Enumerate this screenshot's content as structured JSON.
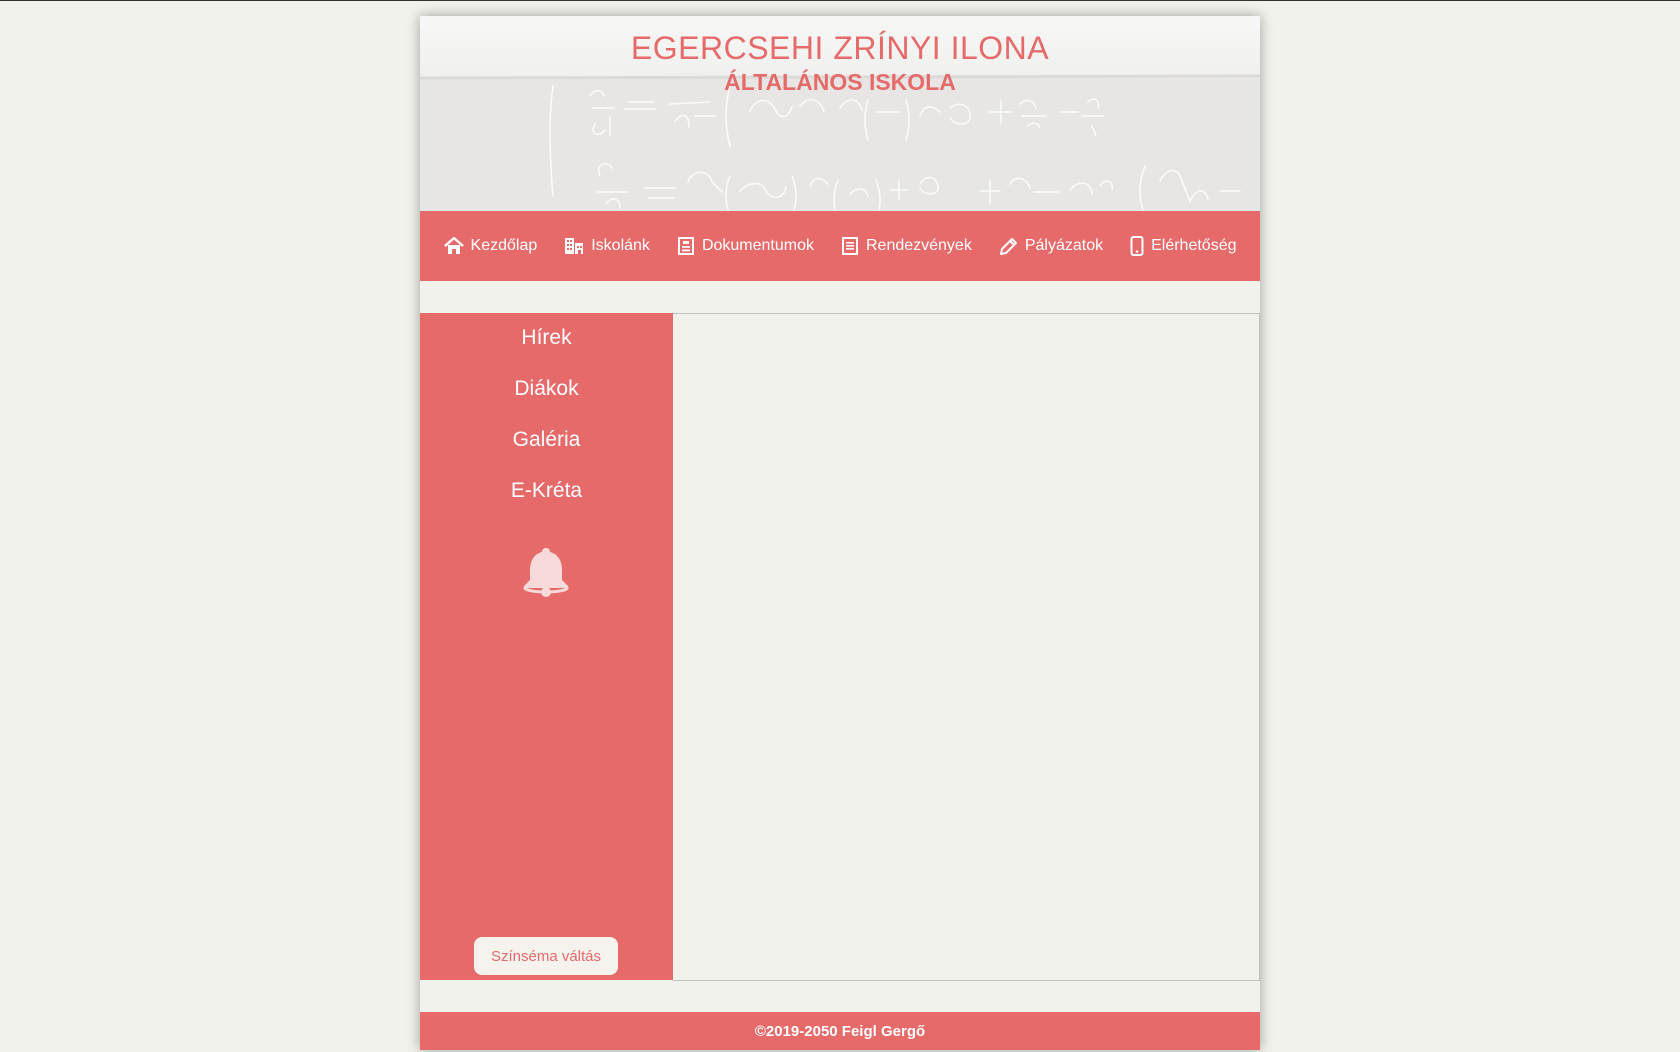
{
  "header": {
    "title": "EGERCSEHI ZRÍNYI ILONA",
    "subtitle": "ÁLTALÁNOS ISKOLA"
  },
  "nav": {
    "items": [
      {
        "label": "Kezdőlap",
        "icon": "home-icon"
      },
      {
        "label": "Iskolánk",
        "icon": "building-icon"
      },
      {
        "label": "Dokumentumok",
        "icon": "document-icon"
      },
      {
        "label": "Rendezvények",
        "icon": "list-document-icon"
      },
      {
        "label": "Pályázatok",
        "icon": "pencil-icon"
      },
      {
        "label": "Elérhetőség",
        "icon": "mobile-phone-icon"
      }
    ]
  },
  "sidebar": {
    "links": [
      {
        "label": "Hírek"
      },
      {
        "label": "Diákok"
      },
      {
        "label": "Galéria"
      },
      {
        "label": "E-Kréta"
      }
    ],
    "bell_icon": "bell-icon",
    "theme_button": "Színséma váltás"
  },
  "footer": {
    "text": "©2019-2050 Feigl Gergő"
  },
  "colors": {
    "accent": "#e66a6a",
    "background": "#f2f2ec",
    "title": "#e56b6b"
  }
}
